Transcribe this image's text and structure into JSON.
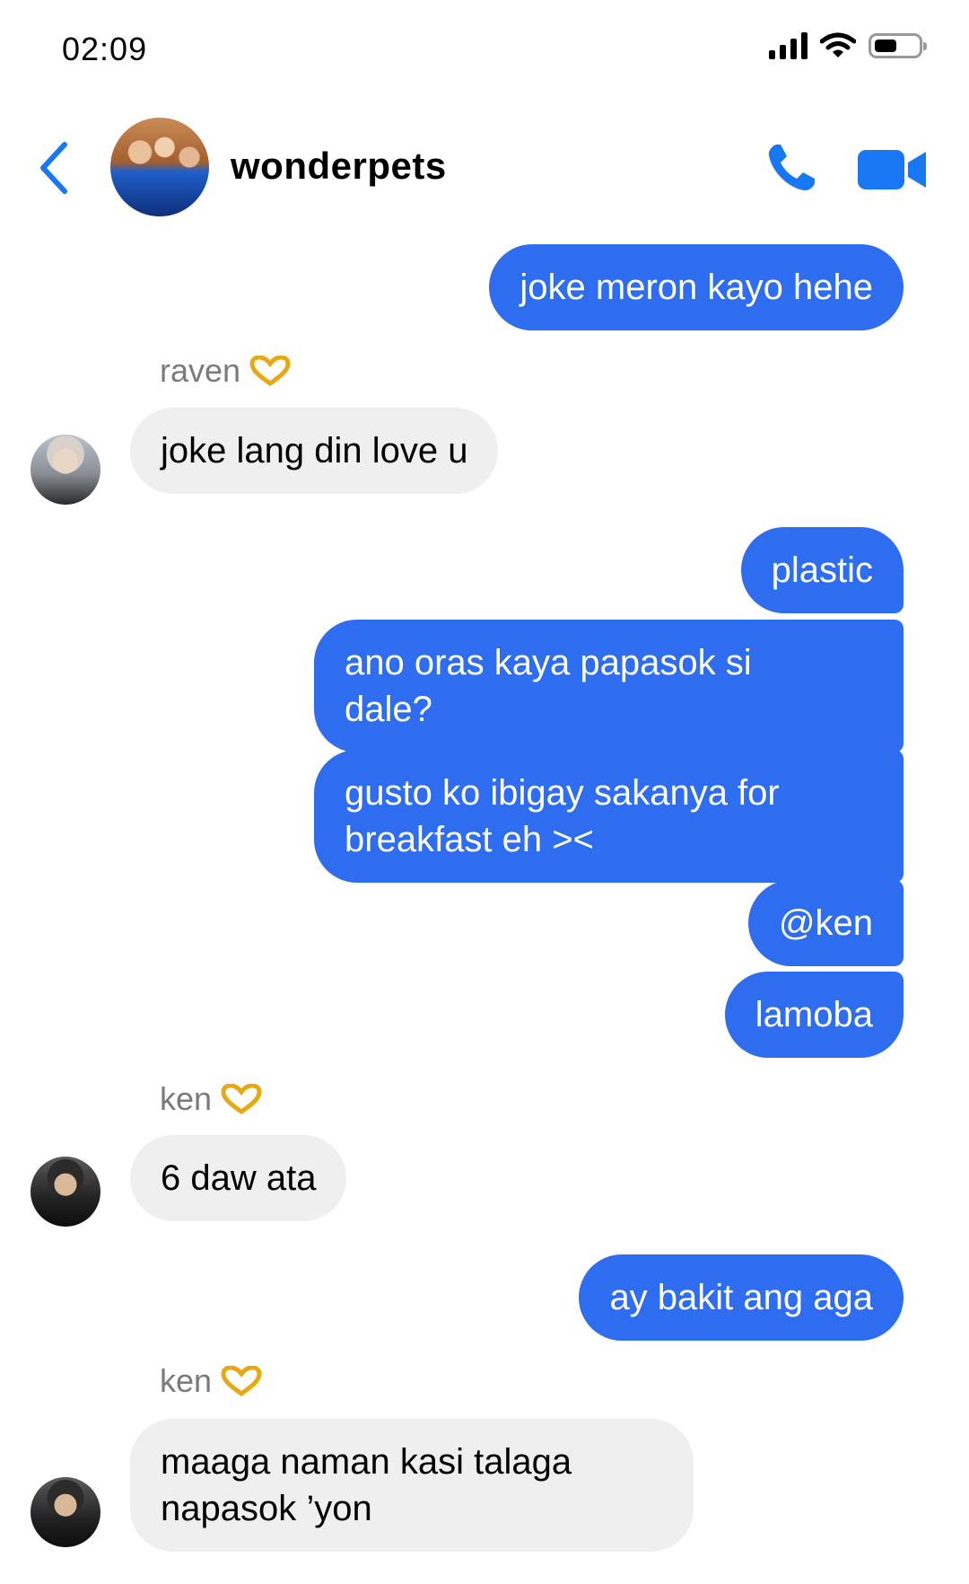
{
  "status": {
    "time": "02:09"
  },
  "header": {
    "title": "wonderpets"
  },
  "colors": {
    "accent": "#1877F2",
    "outgoing_bubble": "#2F6DF0",
    "incoming_bubble": "#EFEFEF"
  },
  "messages": {
    "m1": "joke meron kayo hehe",
    "sender_raven": "raven",
    "m2": "joke lang din love u",
    "m3": "plastic",
    "m4_line1": "ano oras kaya papasok si",
    "m4_line2": "dale?",
    "m5_line1": "gusto ko ibigay sakanya for",
    "m5_line2": "breakfast eh ><",
    "m6": "@ken",
    "m7": "lamoba",
    "sender_ken_1": "ken",
    "m8": "6 daw ata",
    "m9": "ay bakit ang aga",
    "sender_ken_2": "ken",
    "m10_line1": "maaga naman kasi talaga",
    "m10_line2": "napasok ’yon"
  },
  "icons": {
    "back": "chevron-left-icon",
    "call": "phone-icon",
    "video": "video-camera-icon",
    "reaction": "heart-hands-emoji"
  }
}
